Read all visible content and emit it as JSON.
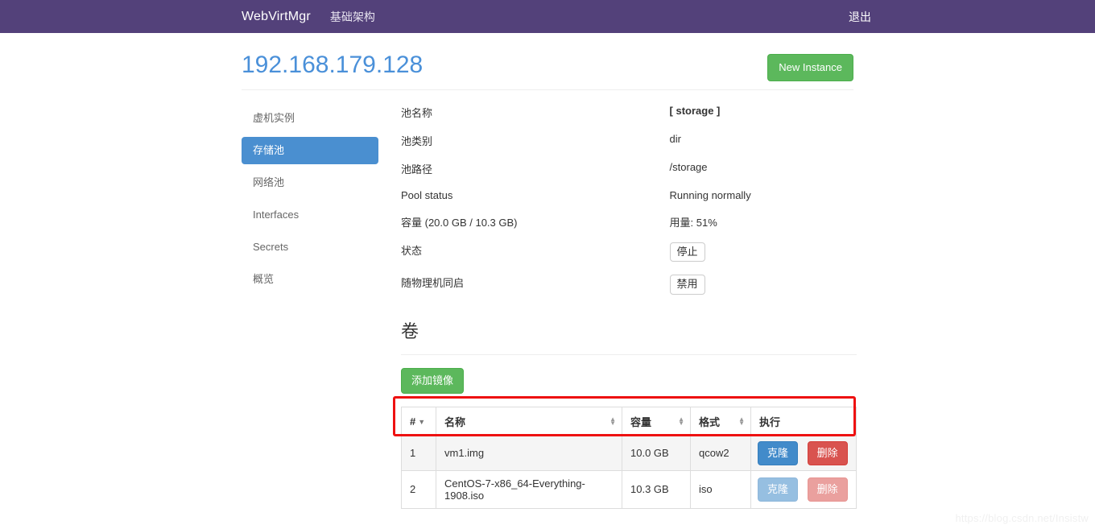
{
  "navbar": {
    "brand": "WebVirtMgr",
    "links": [
      {
        "label": "基础架构"
      }
    ],
    "logout_label": "退出",
    "background_color": "#53417a"
  },
  "header": {
    "title": "192.168.179.128",
    "title_color": "#4a90d9",
    "new_instance_label": "New Instance",
    "new_instance_color": "#5cb85c"
  },
  "sidebar": {
    "items": [
      {
        "label": "虚机实例",
        "active": false
      },
      {
        "label": "存储池",
        "active": true
      },
      {
        "label": "网络池",
        "active": false
      },
      {
        "label": "Interfaces",
        "active": false
      },
      {
        "label": "Secrets",
        "active": false
      },
      {
        "label": "概览",
        "active": false
      }
    ],
    "active_color": "#4a8fd0"
  },
  "pool": {
    "rows": [
      {
        "label": "池名称",
        "value": "[ storage ]",
        "bold": true
      },
      {
        "label": "池类别",
        "value": "dir",
        "bold": false
      },
      {
        "label": "池路径",
        "value": "/storage",
        "bold": false
      },
      {
        "label": "Pool status",
        "value": "Running normally",
        "bold": false
      },
      {
        "label": "容量 (20.0 GB / 10.3 GB)",
        "value": "用量: 51%",
        "bold": false
      }
    ],
    "state_label": "状态",
    "state_button": "停止",
    "autostart_label": "随物理机同启",
    "autostart_button": "禁用"
  },
  "volumes": {
    "section_title": "卷",
    "add_image_label": "添加镜像",
    "columns": {
      "num": "#",
      "name": "名称",
      "size": "容量",
      "format": "格式",
      "actions": "执行"
    },
    "rows": [
      {
        "num": "1",
        "name": "vm1.img",
        "size": "10.0 GB",
        "format": "qcow2",
        "clone_label": "克隆",
        "delete_label": "删除",
        "highlighted": true
      },
      {
        "num": "2",
        "name": "CentOS-7-x86_64-Everything-1908.iso",
        "size": "10.3 GB",
        "format": "iso",
        "clone_label": "克隆",
        "delete_label": "删除",
        "highlighted": false
      }
    ],
    "clone_color": "#428bca",
    "delete_color": "#d9534f"
  },
  "annotation": {
    "color": "#ee1111"
  },
  "watermark": {
    "text": "https://blog.csdn.net/Insistw"
  }
}
